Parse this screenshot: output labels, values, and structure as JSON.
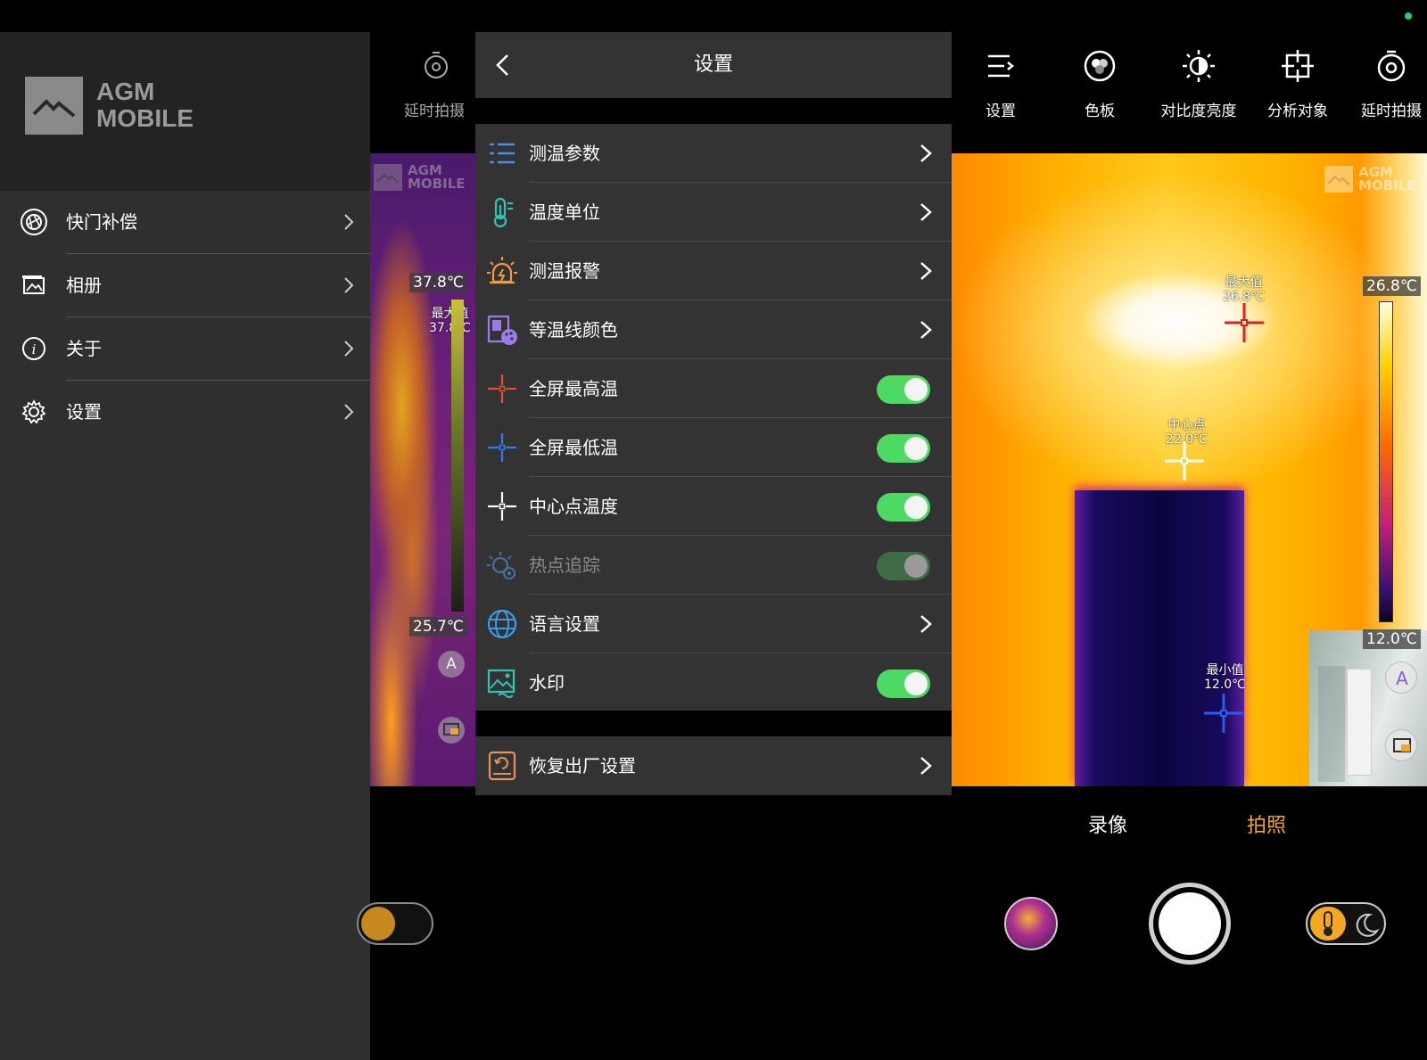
{
  "brand": {
    "line1": "AGM",
    "line2": "MOBILE"
  },
  "sidebar": {
    "items": [
      {
        "label": "快门补偿"
      },
      {
        "label": "相册"
      },
      {
        "label": "关于"
      },
      {
        "label": "设置"
      }
    ]
  },
  "middle_camera": {
    "tool_label": "延时拍摄",
    "scale_max": "37.8℃",
    "scale_min": "25.7℃",
    "max_marker": "最大值\n37.8℃"
  },
  "settings": {
    "title": "设置",
    "rows": [
      {
        "label": "测温参数",
        "type": "link",
        "icon": "thermometer-list-icon",
        "color": "#4a8fe7"
      },
      {
        "label": "温度单位",
        "type": "link",
        "icon": "thermometer-icon",
        "color": "#2ec4b6"
      },
      {
        "label": "测温报警",
        "type": "link",
        "icon": "alarm-icon",
        "color": "#f39c3d"
      },
      {
        "label": "等温线颜色",
        "type": "link",
        "icon": "palette-icon",
        "color": "#9b7bea"
      },
      {
        "label": "全屏最高温",
        "type": "toggle",
        "on": true,
        "icon": "crosshair-red-icon",
        "color": "#e74c3c"
      },
      {
        "label": "全屏最低温",
        "type": "toggle",
        "on": true,
        "icon": "crosshair-blue-icon",
        "color": "#3a78f2"
      },
      {
        "label": "中心点温度",
        "type": "toggle",
        "on": true,
        "icon": "crosshair-white-icon",
        "color": "#ffffff"
      },
      {
        "label": "热点追踪",
        "type": "toggle",
        "on": true,
        "disabled": true,
        "icon": "hotspot-icon",
        "color": "#4a6fa5"
      },
      {
        "label": "语言设置",
        "type": "link",
        "icon": "globe-icon",
        "color": "#3a9ae8"
      },
      {
        "label": "水印",
        "type": "toggle",
        "on": true,
        "icon": "image-icon",
        "color": "#2ec4b6"
      }
    ],
    "reset": {
      "label": "恢复出厂设置",
      "icon": "reset-icon",
      "color": "#e8915a"
    }
  },
  "camera": {
    "toolbar": [
      {
        "label": "设置",
        "icon": "menu-icon"
      },
      {
        "label": "色板",
        "icon": "palette-circle-icon"
      },
      {
        "label": "对比度亮度",
        "icon": "brightness-icon"
      },
      {
        "label": "分析对象",
        "icon": "target-icon"
      },
      {
        "label": "延时拍摄",
        "icon": "timer-icon"
      }
    ],
    "scale_max": "26.8℃",
    "scale_min": "12.0℃",
    "max_marker": {
      "title": "最大值",
      "value": "26.8℃"
    },
    "center_marker": {
      "title": "中心点",
      "value": "22.0℃"
    },
    "min_marker": {
      "title": "最小值",
      "value": "12.0℃"
    },
    "modes": {
      "video": "录像",
      "photo": "拍照"
    },
    "colors": {
      "accent": "#f5a623",
      "toggle_on": "#4cd964"
    }
  }
}
